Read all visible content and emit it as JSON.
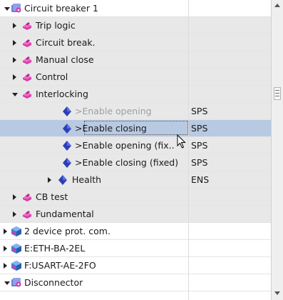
{
  "tree": {
    "rows": [
      {
        "label": "Circuit breaker 1",
        "type": "",
        "icon": "folder-gear-icon"
      },
      {
        "label": "Trip logic",
        "type": "",
        "icon": "function-block-icon"
      },
      {
        "label": "Circuit break.",
        "type": "",
        "icon": "function-block-icon"
      },
      {
        "label": "Manual close",
        "type": "",
        "icon": "function-block-icon"
      },
      {
        "label": "Control",
        "type": "",
        "icon": "function-block-icon"
      },
      {
        "label": "Interlocking",
        "type": "",
        "icon": "function-block-icon"
      },
      {
        "label": ">Enable opening",
        "type": "SPS",
        "icon": "signal-diamond-icon"
      },
      {
        "label": ">Enable closing",
        "type": "SPS",
        "icon": "signal-diamond-icon"
      },
      {
        "label": ">Enable opening (fix..",
        "type": "SPS",
        "icon": "signal-diamond-icon"
      },
      {
        "label": ">Enable closing (fixed)",
        "type": "SPS",
        "icon": "signal-diamond-icon"
      },
      {
        "label": "Health",
        "type": "ENS",
        "icon": "signal-diamond-icon"
      },
      {
        "label": "CB test",
        "type": "",
        "icon": "function-block-icon"
      },
      {
        "label": "Fundamental",
        "type": "",
        "icon": "function-block-icon"
      },
      {
        "label": "2 device prot. com.",
        "type": "",
        "icon": "module-cube-icon"
      },
      {
        "label": "E:ETH-BA-2EL",
        "type": "",
        "icon": "module-cube-icon"
      },
      {
        "label": "F:USART-AE-2FO",
        "type": "",
        "icon": "module-cube-icon"
      },
      {
        "label": "Disconnector",
        "type": "",
        "icon": "folder-gear-icon"
      }
    ]
  },
  "colors": {
    "selected_row": "#b8c9e2",
    "diamond": "#2a3fb8",
    "function_block": "#d93aa8",
    "module": "#3b7fd6"
  }
}
